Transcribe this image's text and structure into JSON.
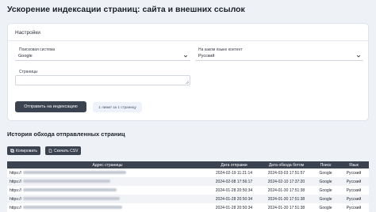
{
  "page_title": "Ускорение индексации страниц: сайта и внешних ссылок",
  "settings": {
    "header": "Настройки",
    "search_engine_label": "Поисковая система",
    "search_engine_value": "Google",
    "content_language_label": "На каком языке контент",
    "content_language_value": "Русский",
    "pages_label": "Страницы",
    "pages_value": "",
    "submit_label": "Отправить на индексацию",
    "limit_text": "1 лимит за 1 страницу"
  },
  "history": {
    "title": "История обхода отправленных страниц",
    "copy_label": "Копировать",
    "csv_label": "Скачать CSV",
    "columns": [
      "Адрес страницы",
      "Дата отправки",
      "Дата обхода ботом",
      "Поиск",
      "Язык"
    ],
    "rows": [
      {
        "url": "https://",
        "sent": "2024-02-19 11:21:14",
        "crawled": "2024-03-03 17:51:57",
        "engine": "Google",
        "lang": "Русский"
      },
      {
        "url": "https://",
        "sent": "2024-02-08 17:56:17",
        "crawled": "2024-02-10 17:37:20",
        "engine": "Google",
        "lang": "Русский"
      },
      {
        "url": "https://",
        "sent": "2024-01-28 20:50:34",
        "crawled": "2024-01-30 17:51:38",
        "engine": "Google",
        "lang": "Русский"
      },
      {
        "url": "https://",
        "sent": "2024-01-28 20:50:34",
        "crawled": "2024-01-30 17:51:38",
        "engine": "Google",
        "lang": "Русский"
      },
      {
        "url": "https://",
        "sent": "2024-01-28 20:50:34",
        "crawled": "2024-01-30 17:51:38",
        "engine": "Google",
        "lang": "Русский"
      }
    ]
  }
}
